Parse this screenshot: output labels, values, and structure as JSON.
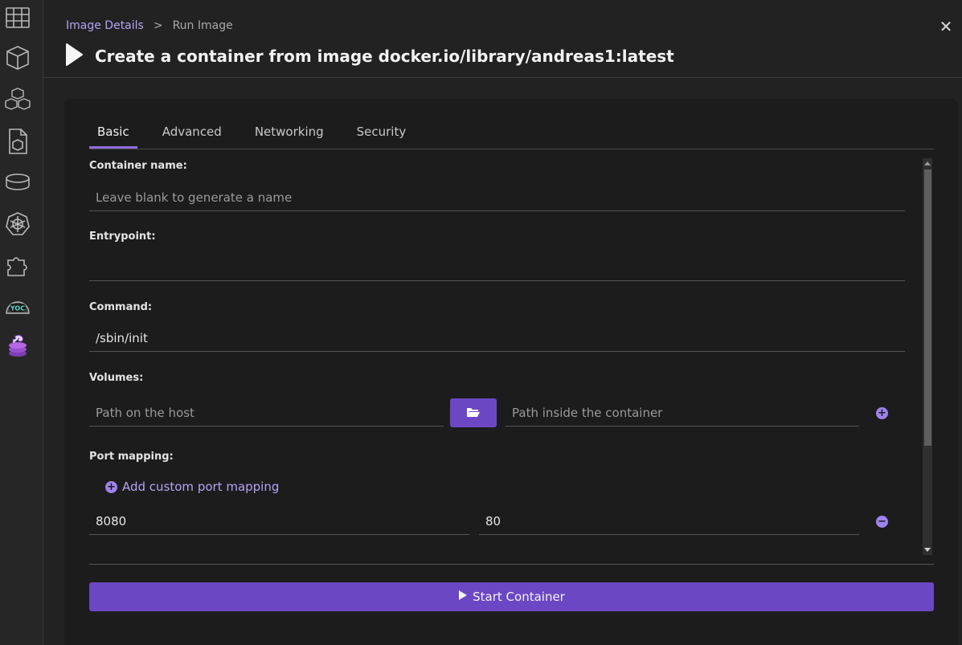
{
  "sidebar": {
    "items": [
      {
        "name": "dashboard-icon"
      },
      {
        "name": "container-icon"
      },
      {
        "name": "pods-icon"
      },
      {
        "name": "images-icon"
      },
      {
        "name": "volumes-icon"
      },
      {
        "name": "kubernetes-icon"
      },
      {
        "name": "extensions-icon"
      },
      {
        "name": "extension-app-icon"
      },
      {
        "name": "extension-stack-icon"
      }
    ]
  },
  "header": {
    "breadcrumb": {
      "parent": "Image Details",
      "separator": ">",
      "current": "Run Image"
    },
    "title": "Create a container from image docker.io/library/andreas1:latest",
    "close_symbol": "✕"
  },
  "tabs": [
    {
      "label": "Basic",
      "active": true
    },
    {
      "label": "Advanced",
      "active": false
    },
    {
      "label": "Networking",
      "active": false
    },
    {
      "label": "Security",
      "active": false
    }
  ],
  "form": {
    "container_name": {
      "label": "Container name:",
      "value": "",
      "placeholder": "Leave blank to generate a name"
    },
    "entrypoint": {
      "label": "Entrypoint:",
      "value": "",
      "placeholder": ""
    },
    "command": {
      "label": "Command:",
      "value": "/sbin/init",
      "placeholder": ""
    },
    "volumes": {
      "label": "Volumes:",
      "host_placeholder": "Path on the host",
      "container_placeholder": "Path inside the container",
      "add_symbol": "+"
    },
    "port_mapping": {
      "label": "Port mapping:",
      "add_label": "Add custom port mapping",
      "add_symbol": "+",
      "host_port": "8080",
      "container_port": "80",
      "remove_symbol": "−"
    }
  },
  "actions": {
    "start_label": "Start Container"
  },
  "colors": {
    "accent": "#6c47c4",
    "accent_light": "#b6a3f5",
    "background": "#222222",
    "card": "#1c1c1c"
  }
}
